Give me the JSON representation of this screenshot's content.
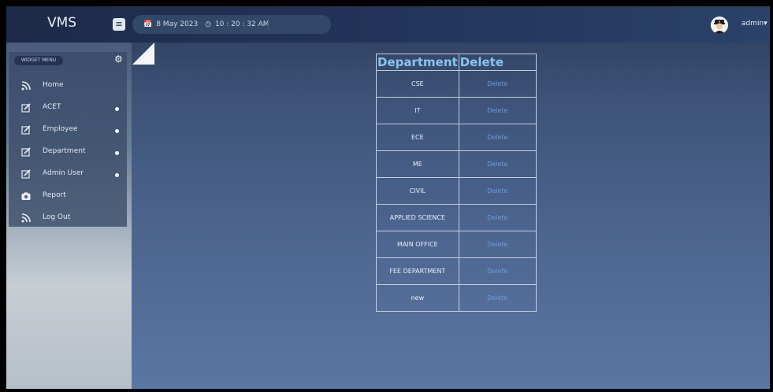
{
  "app": {
    "title": "VMS"
  },
  "header": {
    "menu_toggle_icon": "hamburger-icon",
    "date": "8 May 2023",
    "time": "10 : 20 : 32 AM",
    "calendar_icon": "calendar-icon",
    "clock_icon": "clock-icon",
    "user": {
      "avatar_icon": "officer-avatar-icon",
      "name": "admin"
    }
  },
  "sidebar": {
    "widget_menu_label": "WIDGET MENU",
    "settings_icon": "gear-icon",
    "items": [
      {
        "label": "Home",
        "icon": "rss-icon",
        "has_dot": false
      },
      {
        "label": "ACET",
        "icon": "edit-icon",
        "has_dot": true
      },
      {
        "label": "Employee",
        "icon": "edit-icon",
        "has_dot": true
      },
      {
        "label": "Department",
        "icon": "edit-icon",
        "has_dot": true
      },
      {
        "label": "Admin User",
        "icon": "edit-icon",
        "has_dot": true
      },
      {
        "label": "Report",
        "icon": "camera-icon",
        "has_dot": false
      },
      {
        "label": "Log Out",
        "icon": "rss-icon",
        "has_dot": false
      }
    ]
  },
  "table": {
    "columns": [
      "Department",
      "Delete"
    ],
    "rows": [
      {
        "department": "CSE",
        "action": "Delete"
      },
      {
        "department": "IT",
        "action": "Delete"
      },
      {
        "department": "ECE",
        "action": "Delete"
      },
      {
        "department": "ME",
        "action": "Delete"
      },
      {
        "department": "CIVIL",
        "action": "Delete"
      },
      {
        "department": "APPLIED SCIENCE",
        "action": "Delete"
      },
      {
        "department": "MAIN OFFICE",
        "action": "Delete"
      },
      {
        "department": "FEE DEPARTMENT",
        "action": "Delete"
      },
      {
        "department": "new",
        "action": "Delete"
      }
    ]
  },
  "colors": {
    "header_bg": "#1c2b47",
    "content_bg": "#4d6690",
    "table_header_text": "#87c4ec",
    "delete_link": "#6c9be0"
  }
}
